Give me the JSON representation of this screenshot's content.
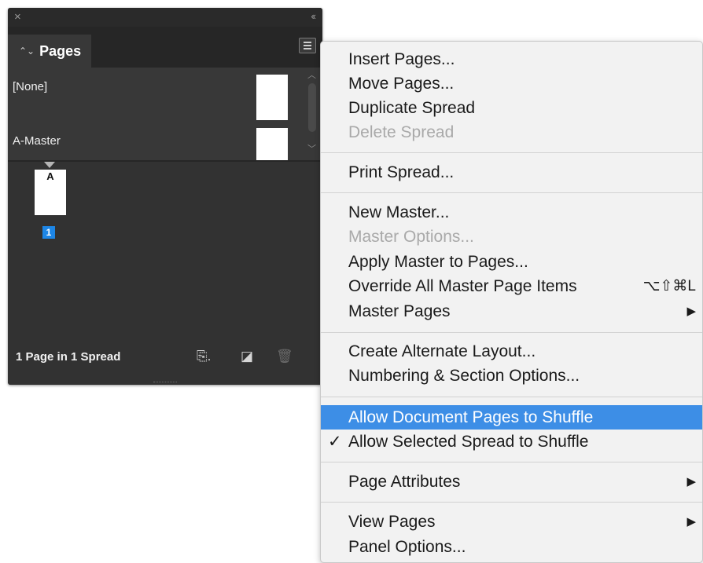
{
  "panel": {
    "close_glyph": "×",
    "collapse_glyph": "‹‹",
    "tab_arrows": "⌃⌄",
    "tab_label": "Pages",
    "masters": [
      {
        "label": "[None]"
      },
      {
        "label": "A-Master"
      }
    ],
    "page": {
      "prefix": "A",
      "number": "1",
      "selected_color": "#1d86e6"
    },
    "status_text": "1 Page in 1 Spread",
    "icons": [
      "edit-page-size-icon",
      "new-page-icon",
      "delete-page-icon"
    ]
  },
  "menu": {
    "items": [
      {
        "label": "Insert Pages...",
        "disabled": false
      },
      {
        "label": "Move Pages...",
        "disabled": false
      },
      {
        "label": "Duplicate Spread",
        "disabled": false
      },
      {
        "label": "Delete Spread",
        "disabled": true
      },
      {
        "label": "Print Spread...",
        "disabled": false
      },
      {
        "label": "New Master...",
        "disabled": false
      },
      {
        "label": "Master Options...",
        "disabled": true
      },
      {
        "label": "Apply Master to Pages...",
        "disabled": false
      },
      {
        "label": "Override All Master Page Items",
        "disabled": false,
        "shortcut": "⌥⇧⌘L"
      },
      {
        "label": "Master Pages",
        "disabled": false,
        "submenu": true
      },
      {
        "label": "Create Alternate Layout...",
        "disabled": false
      },
      {
        "label": "Numbering & Section Options...",
        "disabled": false
      },
      {
        "label": "Allow Document Pages to Shuffle",
        "disabled": false,
        "highlighted": true
      },
      {
        "label": "Allow Selected Spread to Shuffle",
        "disabled": false,
        "checked": true,
        "check_glyph": "✓"
      },
      {
        "label": "Page Attributes",
        "disabled": false,
        "submenu": true
      },
      {
        "label": "View Pages",
        "disabled": false,
        "submenu": true
      },
      {
        "label": "Panel Options...",
        "disabled": false
      }
    ],
    "submenu_glyph": "▶",
    "highlight_color": "#3d8ee6"
  }
}
